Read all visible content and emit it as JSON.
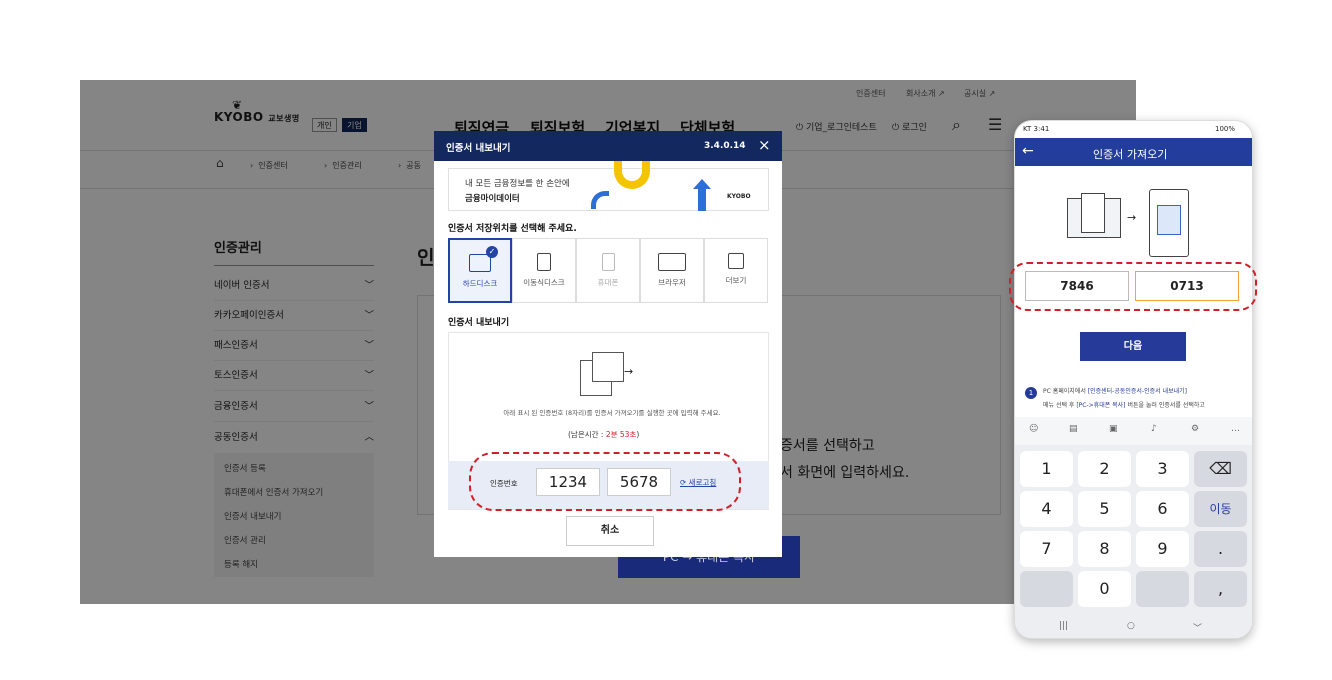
{
  "util_links": [
    "인증센터",
    "회사소개",
    "공시실"
  ],
  "logo": {
    "text": "KYOBO",
    "sub": "교보생명"
  },
  "segment": [
    "개인",
    "기업"
  ],
  "gnb": [
    "퇴직연금",
    "퇴직보험",
    "기업복지",
    "단체보험"
  ],
  "header_right": {
    "company": "기업_로그인테스트",
    "login": "로그인"
  },
  "breadcrumb": [
    "인증센터",
    "인증관리",
    "공동"
  ],
  "sidebar": {
    "title": "인증관리",
    "items": [
      "네이버 인증서",
      "카카오페이인증서",
      "패스인증서",
      "토스인증서",
      "금융인증서",
      "공동인증서"
    ],
    "sub_items": [
      "인증서 등록",
      "휴대폰에서 인증서 가져오기",
      "인증서 내보내기",
      "인증서 관리",
      "등록 해지"
    ]
  },
  "content": {
    "title_prefix": "인",
    "line1": "증서를 선택하고",
    "line2": "서 화면에 입력하세요.",
    "pc_button": "PC → 휴대폰 복사"
  },
  "modal": {
    "title": "인증서 내보내기",
    "version": "3.4.0.14",
    "close": "×",
    "banner": {
      "line1": "내 모든 금융정보를 한 손안에",
      "line2": "금융마이데이터",
      "logo": "KYOBO"
    },
    "location_label": "인증서 저장위치를 선택해 주세요.",
    "locations": [
      "하드디스크",
      "이동식디스크",
      "휴대폰",
      "브라우저",
      "더보기"
    ],
    "export_label": "인증서 내보내기",
    "instruction": "아래 표시 된 인증번호 (8자리)를 인증서 가져오기를 실행한 곳에 입력해 주세요.",
    "remaining_label": "(남은시간 : ",
    "remaining_time": "2분 53초",
    "remaining_close": ")",
    "code_label": "인증번호",
    "code1": "1234",
    "code2": "5678",
    "refresh": "새로고침",
    "cancel": "취소"
  },
  "phone": {
    "status_left": "KT 3:41",
    "status_right": "100%",
    "back": "←",
    "title": "인증서 가져오기",
    "code1": "7846",
    "code2": "0713",
    "next": "다음",
    "notice_num": "1",
    "notice_l1a": "PC 홈페이지에서 ",
    "notice_l1b": "[인증센터-공동인증서-인증서 내보내기]",
    "notice_l2a": "메뉴 선택 후 ",
    "notice_l2b": "[PC->휴대폰 복사]",
    "notice_l2c": " 버튼을 눌러 인증서를 선택하고",
    "keys": [
      "1",
      "2",
      "3",
      "⌫",
      "4",
      "5",
      "6",
      "이동",
      "7",
      "8",
      "9",
      ".",
      "",
      "0",
      "",
      ","
    ],
    "nav": [
      "|||",
      "○",
      "﹀"
    ]
  },
  "colors": {
    "navy": "#12285e",
    "accent": "#263a9a",
    "red": "#d0202a",
    "orange": "#f5a623"
  }
}
